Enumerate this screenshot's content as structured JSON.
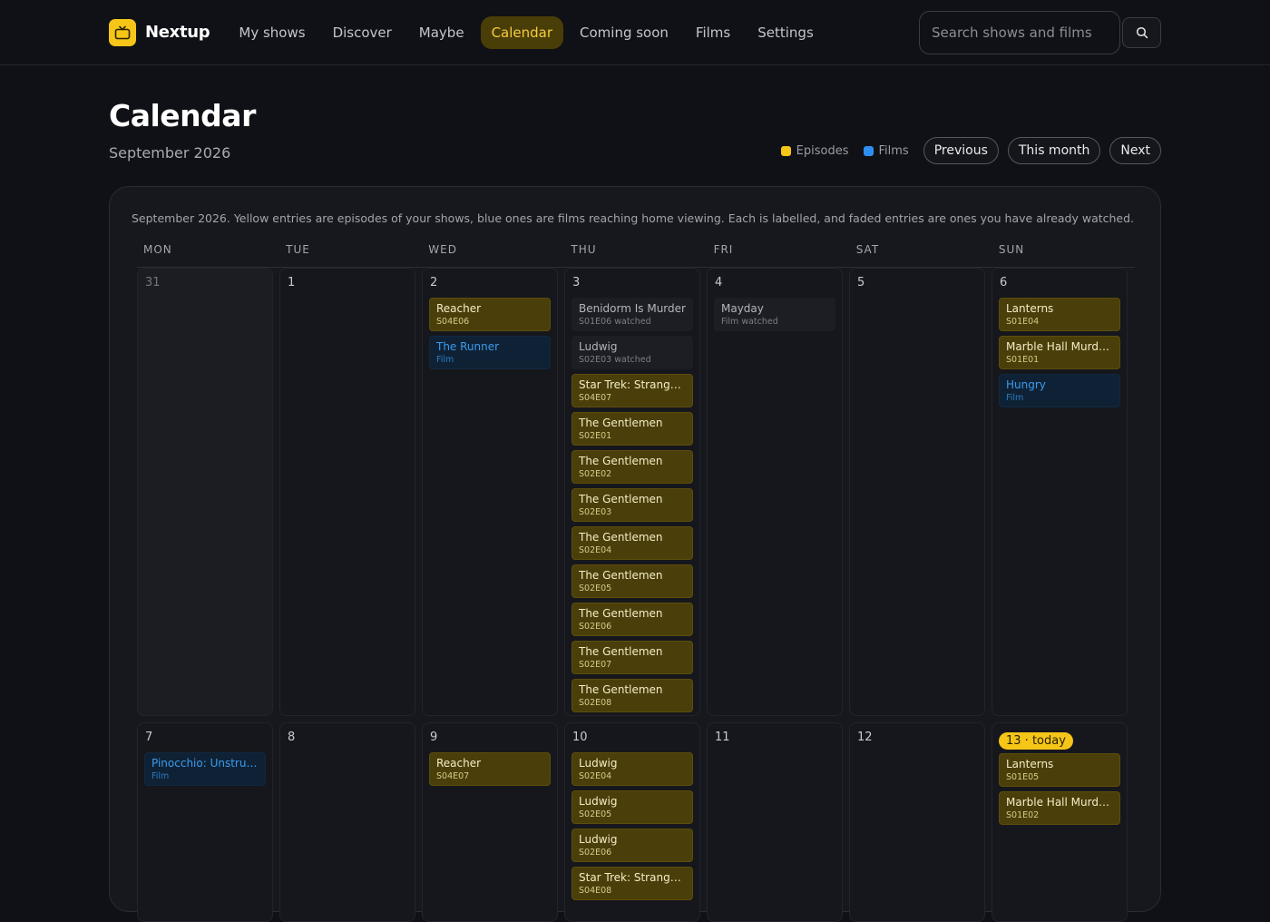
{
  "app": {
    "name": "Nextup"
  },
  "nav": {
    "items": [
      "My shows",
      "Discover",
      "Maybe",
      "Calendar",
      "Coming soon",
      "Films",
      "Settings"
    ],
    "active": "Calendar"
  },
  "search": {
    "placeholder": "Search shows and films",
    "value": ""
  },
  "page": {
    "title": "Calendar",
    "subtitle": "September 2026"
  },
  "legend": {
    "episodes": "Episodes",
    "films": "Films",
    "episode_color": "#f5c518",
    "film_color": "#2f8ff0"
  },
  "controls": {
    "previous": "Previous",
    "this_month": "This month",
    "next": "Next"
  },
  "calendar": {
    "description": "September 2026. Yellow entries are episodes of your shows, blue ones are films reaching home viewing. Each is labelled, and faded entries are ones you have already watched.",
    "weekdays": [
      "MON",
      "TUE",
      "WED",
      "THU",
      "FRI",
      "SAT",
      "SUN"
    ],
    "today_label": "13 · today",
    "weeks": [
      [
        {
          "num": "31",
          "outside": true,
          "entries": []
        },
        {
          "num": "1",
          "entries": []
        },
        {
          "num": "2",
          "entries": [
            {
              "title": "Reacher",
              "sub": "S04E06",
              "kind": "ep"
            },
            {
              "title": "The Runner",
              "sub": "Film",
              "kind": "film"
            }
          ]
        },
        {
          "num": "3",
          "entries": [
            {
              "title": "Benidorm Is Murder",
              "sub": "S01E06 watched",
              "kind": "watched"
            },
            {
              "title": "Ludwig",
              "sub": "S02E03 watched",
              "kind": "watched"
            },
            {
              "title": "Star Trek: Strange New Worlds",
              "sub": "S04E07",
              "kind": "ep"
            },
            {
              "title": "The Gentlemen",
              "sub": "S02E01",
              "kind": "ep"
            },
            {
              "title": "The Gentlemen",
              "sub": "S02E02",
              "kind": "ep"
            },
            {
              "title": "The Gentlemen",
              "sub": "S02E03",
              "kind": "ep"
            },
            {
              "title": "The Gentlemen",
              "sub": "S02E04",
              "kind": "ep"
            },
            {
              "title": "The Gentlemen",
              "sub": "S02E05",
              "kind": "ep"
            },
            {
              "title": "The Gentlemen",
              "sub": "S02E06",
              "kind": "ep"
            },
            {
              "title": "The Gentlemen",
              "sub": "S02E07",
              "kind": "ep"
            },
            {
              "title": "The Gentlemen",
              "sub": "S02E08",
              "kind": "ep"
            }
          ]
        },
        {
          "num": "4",
          "entries": [
            {
              "title": "Mayday",
              "sub": "Film watched",
              "kind": "watched"
            }
          ]
        },
        {
          "num": "5",
          "entries": []
        },
        {
          "num": "6",
          "entries": [
            {
              "title": "Lanterns",
              "sub": "S01E04",
              "kind": "ep"
            },
            {
              "title": "Marble Hall Murders",
              "sub": "S01E01",
              "kind": "ep"
            },
            {
              "title": "Hungry",
              "sub": "Film",
              "kind": "film"
            }
          ]
        }
      ],
      [
        {
          "num": "7",
          "entries": [
            {
              "title": "Pinocchio: Unstrung",
              "sub": "Film",
              "kind": "film"
            }
          ]
        },
        {
          "num": "8",
          "entries": []
        },
        {
          "num": "9",
          "entries": [
            {
              "title": "Reacher",
              "sub": "S04E07",
              "kind": "ep"
            }
          ]
        },
        {
          "num": "10",
          "entries": [
            {
              "title": "Ludwig",
              "sub": "S02E04",
              "kind": "ep"
            },
            {
              "title": "Ludwig",
              "sub": "S02E05",
              "kind": "ep"
            },
            {
              "title": "Ludwig",
              "sub": "S02E06",
              "kind": "ep"
            },
            {
              "title": "Star Trek: Strange New Worlds",
              "sub": "S04E08",
              "kind": "ep"
            }
          ]
        },
        {
          "num": "11",
          "entries": []
        },
        {
          "num": "12",
          "entries": []
        },
        {
          "num": "13",
          "today": true,
          "entries": [
            {
              "title": "Lanterns",
              "sub": "S01E05",
              "kind": "ep"
            },
            {
              "title": "Marble Hall Murders",
              "sub": "S01E02",
              "kind": "ep"
            }
          ]
        }
      ]
    ]
  }
}
